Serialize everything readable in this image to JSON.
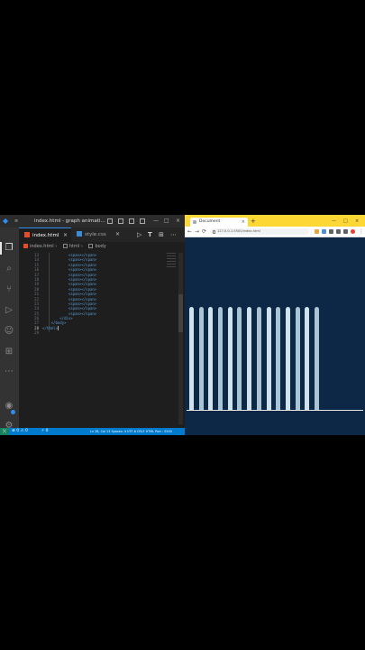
{
  "vscode": {
    "window_title": "index.html - graph animati...",
    "tabs": [
      {
        "label": "index.html",
        "close": "×"
      },
      {
        "label": "style.css",
        "close": "×"
      }
    ],
    "breadcrumbs": [
      "index.html",
      "html",
      "body"
    ],
    "breadcrumb_sep": "›",
    "line_numbers": [
      "13",
      "14",
      "15",
      "16",
      "17",
      "18",
      "19",
      "20",
      "21",
      "22",
      "23",
      "24",
      "25",
      "26",
      "27",
      "28",
      "29"
    ],
    "current_line": "28",
    "code_lines": [
      {
        "indent": "            ",
        "tag": "<span></span>"
      },
      {
        "indent": "            ",
        "tag": "<span></span>"
      },
      {
        "indent": "            ",
        "tag": "<span></span>"
      },
      {
        "indent": "            ",
        "tag": "<span></span>"
      },
      {
        "indent": "            ",
        "tag": "<span></span>"
      },
      {
        "indent": "            ",
        "tag": "<span></span>"
      },
      {
        "indent": "            ",
        "tag": "<span></span>"
      },
      {
        "indent": "            ",
        "tag": "<span></span>"
      },
      {
        "indent": "            ",
        "tag": "<span></span>"
      },
      {
        "indent": "            ",
        "tag": "<span></span>"
      },
      {
        "indent": "            ",
        "tag": "<span></span>"
      },
      {
        "indent": "            ",
        "tag": "<span></span>"
      },
      {
        "indent": "            ",
        "tag": "<span></span>"
      },
      {
        "indent": "        ",
        "tag": "</div>"
      },
      {
        "indent": "    ",
        "tag": "</body>"
      },
      {
        "indent": "",
        "tag": "</html>"
      },
      {
        "indent": "",
        "tag": ""
      }
    ],
    "status": {
      "remote": "⟩⟨",
      "errors": "⊗ 0 ⚠ 0",
      "port": "⚡ 0",
      "right": "Ln 28, Col 13   Spaces: 4   UTF-8   CRLF   HTML   Port : 5500"
    },
    "window_controls": [
      "—",
      "□",
      "×"
    ],
    "editor_actions": [
      "▷",
      "⊞",
      "⋯"
    ]
  },
  "browser": {
    "tab_title": "Document",
    "tab_close": "×",
    "new_tab": "+",
    "url": "127.0.0.1:5500/index.html",
    "nav": [
      "←",
      "→",
      "⟳"
    ],
    "window_controls": [
      "—",
      "□",
      "×"
    ],
    "extension_colors": [
      "#e8a33d",
      "#4a90d9",
      "#5f6368",
      "#5f6368",
      "#5f6368",
      "#e94235"
    ]
  },
  "colors": {
    "page_bg": "#0d2847",
    "bar_colors": [
      "#d0e2ee",
      "#a9c4d4"
    ],
    "vscode_accent": "#007acc"
  },
  "chart_data": {
    "type": "bar",
    "values": [
      0.63,
      0.63,
      0.63,
      0.63,
      0.63,
      0.63,
      0.63,
      0.63,
      0.63,
      0.63,
      0.63,
      0.63,
      0.63,
      0.63
    ],
    "ylim": [
      0,
      1
    ]
  }
}
